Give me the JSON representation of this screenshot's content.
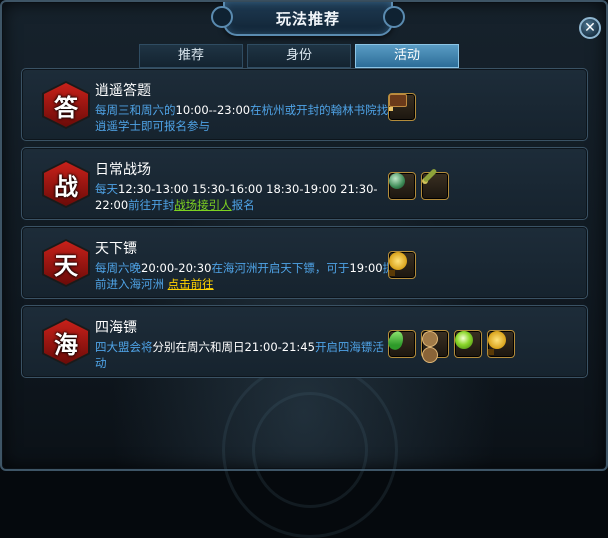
{
  "window": {
    "title": "玩法推荐",
    "close_glyph": "✕"
  },
  "tabs": [
    {
      "label": "推荐",
      "active": false
    },
    {
      "label": "身份",
      "active": false
    },
    {
      "label": "活动",
      "active": true
    }
  ],
  "activities": [
    {
      "badge": "答",
      "title": "逍遥答题",
      "desc": [
        {
          "text": "每周三和周六的",
          "style": "normal"
        },
        {
          "text": "10:00--23:00",
          "style": "hi"
        },
        {
          "text": "在杭州或开封的翰林书院找逍遥学士即可报名参与",
          "style": "normal"
        }
      ],
      "items": [
        "treasure-chest-icon"
      ]
    },
    {
      "badge": "战",
      "title": "日常战场",
      "desc": [
        {
          "text": "每天",
          "style": "normal"
        },
        {
          "text": "12:30-13:00 15:30-16:00 18:30-19:00 21:30-22:00",
          "style": "hi"
        },
        {
          "text": "前往开封",
          "style": "normal"
        },
        {
          "text": "战场接引人",
          "style": "link-green"
        },
        {
          "text": "报名",
          "style": "normal"
        }
      ],
      "items": [
        "jade-orb-icon",
        "green-scroll-icon"
      ]
    },
    {
      "badge": "天",
      "title": "天下镖",
      "desc": [
        {
          "text": "每周六晚",
          "style": "normal"
        },
        {
          "text": "20:00-20:30",
          "style": "hi"
        },
        {
          "text": "在海河洲开启天下镖，可于",
          "style": "normal"
        },
        {
          "text": "19:00",
          "style": "hi"
        },
        {
          "text": "提前进入海河洲  ",
          "style": "normal"
        },
        {
          "text": "点击前往",
          "style": "link-yellow"
        }
      ],
      "items": [
        "gold-coin-icon"
      ]
    },
    {
      "badge": "海",
      "title": "四海镖",
      "desc": [
        {
          "text": "四大盟会将",
          "style": "normal"
        },
        {
          "text": "分别在周六和周日",
          "style": "hi"
        },
        {
          "text": "21:00-21:45",
          "style": "hi"
        },
        {
          "text": "开启四海镖活动",
          "style": "normal"
        }
      ],
      "items": [
        "green-leaf-icon",
        "copper-coins-icon",
        "green-gem-icon",
        "gold-coin-icon"
      ]
    }
  ],
  "colors": {
    "desc_text": "#4fa3e6",
    "highlight_text": "#ffffff",
    "link_green": "#7ed321",
    "link_yellow": "#ffd200",
    "active_tab": "#3d84b2",
    "badge_red": "#c8211a"
  }
}
